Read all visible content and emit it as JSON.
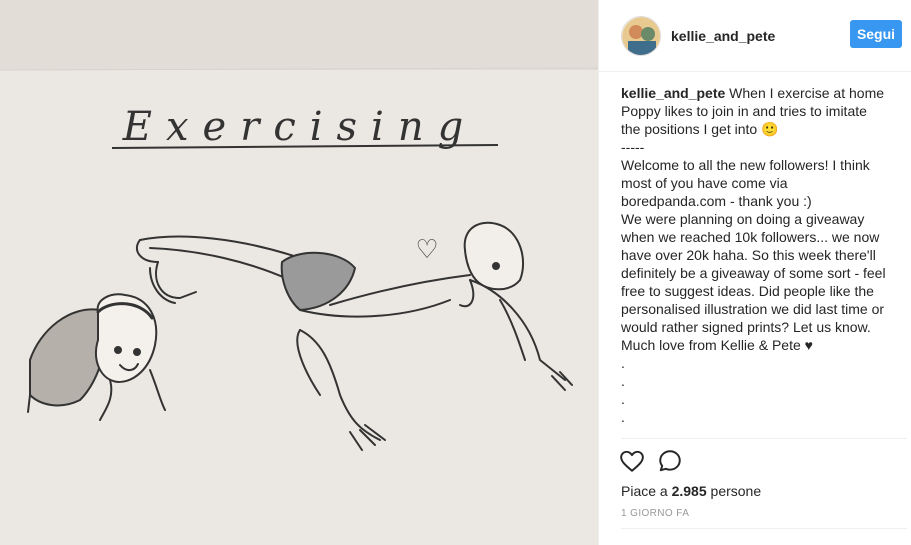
{
  "post": {
    "image": {
      "title_text": "Exercising",
      "heart_glyph": "♡"
    },
    "header": {
      "username": "kellie_and_pete",
      "follow_label": "Segui"
    },
    "caption": {
      "username": "kellie_and_pete",
      "lines": [
        " When I exercise at home",
        "Poppy likes to join in and tries to imitate",
        "the positions I get into 🙂",
        "-----",
        "Welcome to all the new followers! I think",
        "most of you have come via",
        "boredpanda.com - thank you :)",
        "We were planning on doing a giveaway",
        "when we reached 10k followers... we now",
        "have over 20k haha. So this week there'll",
        "definitely be a giveaway of some sort - feel",
        "free to suggest ideas. Did people like the",
        "personalised illustration we did last time or",
        "would rather signed prints? Let us know.",
        "Much love from Kellie & Pete ♥",
        ".",
        ".",
        ".",
        "."
      ]
    },
    "actions": {
      "like_icon": "heart-outline-icon",
      "comment_icon": "comment-bubble-icon"
    },
    "likes": {
      "prefix": "Piace a ",
      "count": "2.985",
      "suffix": " persone"
    },
    "timestamp": "1 GIORNO FA"
  },
  "colors": {
    "accent": "#3897f0",
    "paper": "#ebe7e2",
    "ink": "#333333"
  }
}
